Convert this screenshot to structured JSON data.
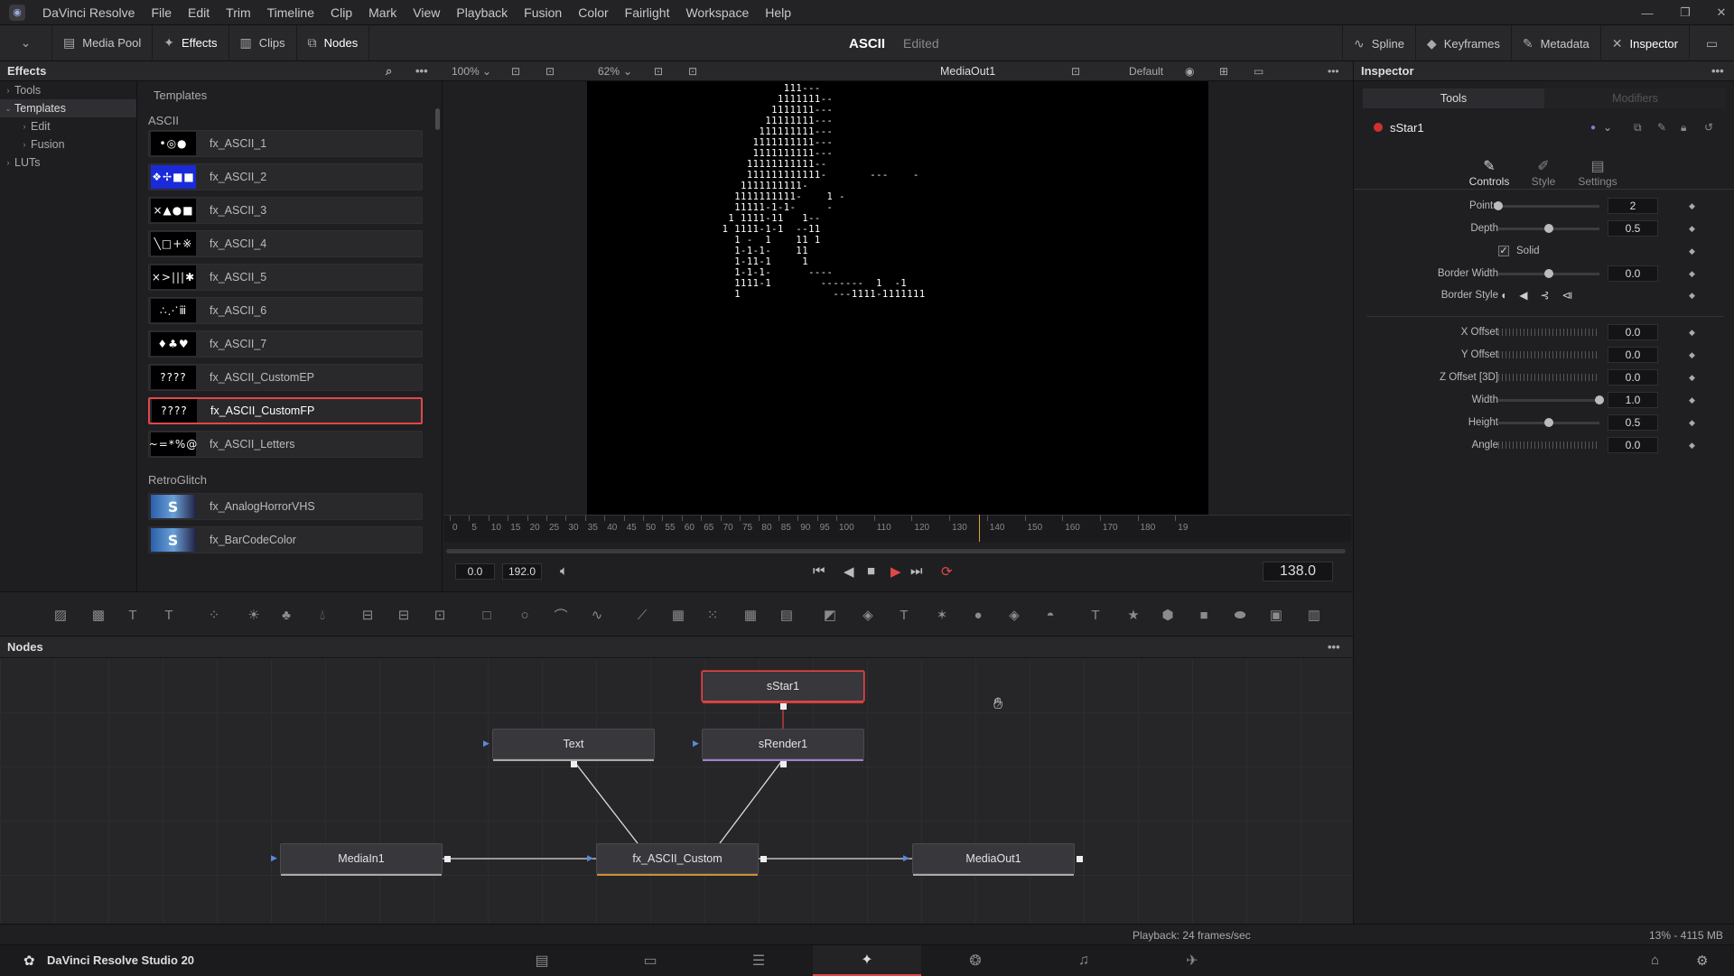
{
  "app": {
    "name": "DaVinci Resolve",
    "version_label": "DaVinci Resolve Studio 20"
  },
  "menu": [
    "DaVinci Resolve",
    "File",
    "Edit",
    "Trim",
    "Timeline",
    "Clip",
    "Mark",
    "View",
    "Playback",
    "Fusion",
    "Color",
    "Fairlight",
    "Workspace",
    "Help"
  ],
  "toolbar": {
    "media_pool": "Media Pool",
    "effects": "Effects",
    "clips": "Clips",
    "nodes": "Nodes",
    "project_title": "ASCII",
    "project_status": "Edited",
    "spline": "Spline",
    "keyframes": "Keyframes",
    "metadata": "Metadata",
    "inspector": "Inspector"
  },
  "effects": {
    "header": "Effects",
    "tree": [
      {
        "label": "Tools",
        "arrow": "›",
        "indent": 0
      },
      {
        "label": "Templates",
        "arrow": "⌄",
        "indent": 0
      },
      {
        "label": "Edit",
        "arrow": "›",
        "indent": 1
      },
      {
        "label": "Fusion",
        "arrow": "›",
        "indent": 1
      },
      {
        "label": "LUTs",
        "arrow": "›",
        "indent": 0
      }
    ],
    "templates_title": "Templates",
    "groups": [
      {
        "name": "ASCII"
      },
      {
        "name": "RetroGlitch"
      }
    ],
    "items": [
      {
        "label": "fx_ASCII_1",
        "thumb": "•◎●"
      },
      {
        "label": "fx_ASCII_2",
        "thumb": "❖✢■■"
      },
      {
        "label": "fx_ASCII_3",
        "thumb": "×▲●■"
      },
      {
        "label": "fx_ASCII_4",
        "thumb": "╲□+※"
      },
      {
        "label": "fx_ASCII_5",
        "thumb": "×>|||✱"
      },
      {
        "label": "fx_ASCII_6",
        "thumb": "∴⋰ⅲ"
      },
      {
        "label": "fx_ASCII_7",
        "thumb": "♦♣♥"
      },
      {
        "label": "fx_ASCII_CustomEP",
        "thumb": "????"
      },
      {
        "label": "fx_ASCII_CustomFP",
        "thumb": "????"
      },
      {
        "label": "fx_ASCII_Letters",
        "thumb": "~=*%@"
      },
      {
        "label": "fx_AnalogHorrorVHS",
        "thumb": "S"
      },
      {
        "label": "fx_BarCodeColor",
        "thumb": "S"
      }
    ]
  },
  "viewer": {
    "zoom_left": "100%",
    "zoom_right": "62%",
    "title": "MediaOut1",
    "lut": "Default",
    "ruler": [
      "0",
      "5",
      "10",
      "15",
      "20",
      "25",
      "30",
      "35",
      "40",
      "45",
      "50",
      "55",
      "60",
      "65",
      "70",
      "75",
      "80",
      "85",
      "90",
      "95",
      "100",
      "110",
      "120",
      "130",
      "140",
      "150",
      "160",
      "170",
      "180",
      "19"
    ],
    "playhead_frame": 138,
    "range_end_frame": 192,
    "in_tc": "0.0",
    "out_tc": "192.0",
    "current_tc": "138.0",
    "ascii_lines": [
      "                  111---",
      "                 1111111--",
      "                1111111---",
      "               11111111---",
      "              111111111---",
      "             1111111111---",
      "             1111111111---",
      "            11111111111--",
      "            111111111111-       ---    -",
      "           1111111111-",
      "          1111111111-    1 -",
      "          11111-1-1-     -",
      "         1 1111-11   1--",
      "        1 1111-1-1  --11",
      "          1 -  1    11 1",
      "          1-1-1-    11   ",
      "          1-11-1     1",
      "          1-1-1-      ----",
      "          1111-1        -------  1  -1",
      "          1               ---1111-1111111"
    ]
  },
  "inspector": {
    "header": "Inspector",
    "tab_tools": "Tools",
    "tab_modifiers": "Modifiers",
    "node_name": "sStar1",
    "subtabs": [
      "Controls",
      "Style",
      "Settings"
    ],
    "props": [
      {
        "label": "Points",
        "value": "2",
        "type": "slider",
        "pos": 0.0
      },
      {
        "label": "Depth",
        "value": "0.5",
        "type": "slider",
        "pos": 0.5
      },
      {
        "label": "Solid",
        "value": "",
        "type": "check",
        "checked": true
      },
      {
        "label": "Border Width",
        "value": "0.0",
        "type": "slider",
        "pos": 0.5
      },
      {
        "label": "Border Style",
        "value": "",
        "type": "icons"
      },
      {
        "label": "X Offset",
        "value": "0.0",
        "type": "dial"
      },
      {
        "label": "Y Offset",
        "value": "0.0",
        "type": "dial"
      },
      {
        "label": "Z Offset [3D]",
        "value": "0.0",
        "type": "dial"
      },
      {
        "label": "Width",
        "value": "1.0",
        "type": "slider",
        "pos": 1.0
      },
      {
        "label": "Height",
        "value": "0.5",
        "type": "slider",
        "pos": 0.5
      },
      {
        "label": "Angle",
        "value": "0.0",
        "type": "dial"
      }
    ]
  },
  "nodes": {
    "header": "Nodes",
    "list": [
      {
        "name": "sStar1",
        "selected": true,
        "ul": "#d04040"
      },
      {
        "name": "Text",
        "selected": false,
        "ul": "#aaa"
      },
      {
        "name": "sRender1",
        "selected": false,
        "ul": "#a080d0"
      },
      {
        "name": "MediaIn1",
        "selected": false,
        "ul": "#aaa"
      },
      {
        "name": "fx_ASCII_Custom",
        "selected": false,
        "ul": "#d09030"
      },
      {
        "name": "MediaOut1",
        "selected": false,
        "ul": "#aaa"
      }
    ]
  },
  "status": {
    "playback": "Playback: 24 frames/sec",
    "memory": "13% - 4115 MB"
  },
  "colors": {
    "accent": "#e04848",
    "panel": "#1f1f22"
  }
}
